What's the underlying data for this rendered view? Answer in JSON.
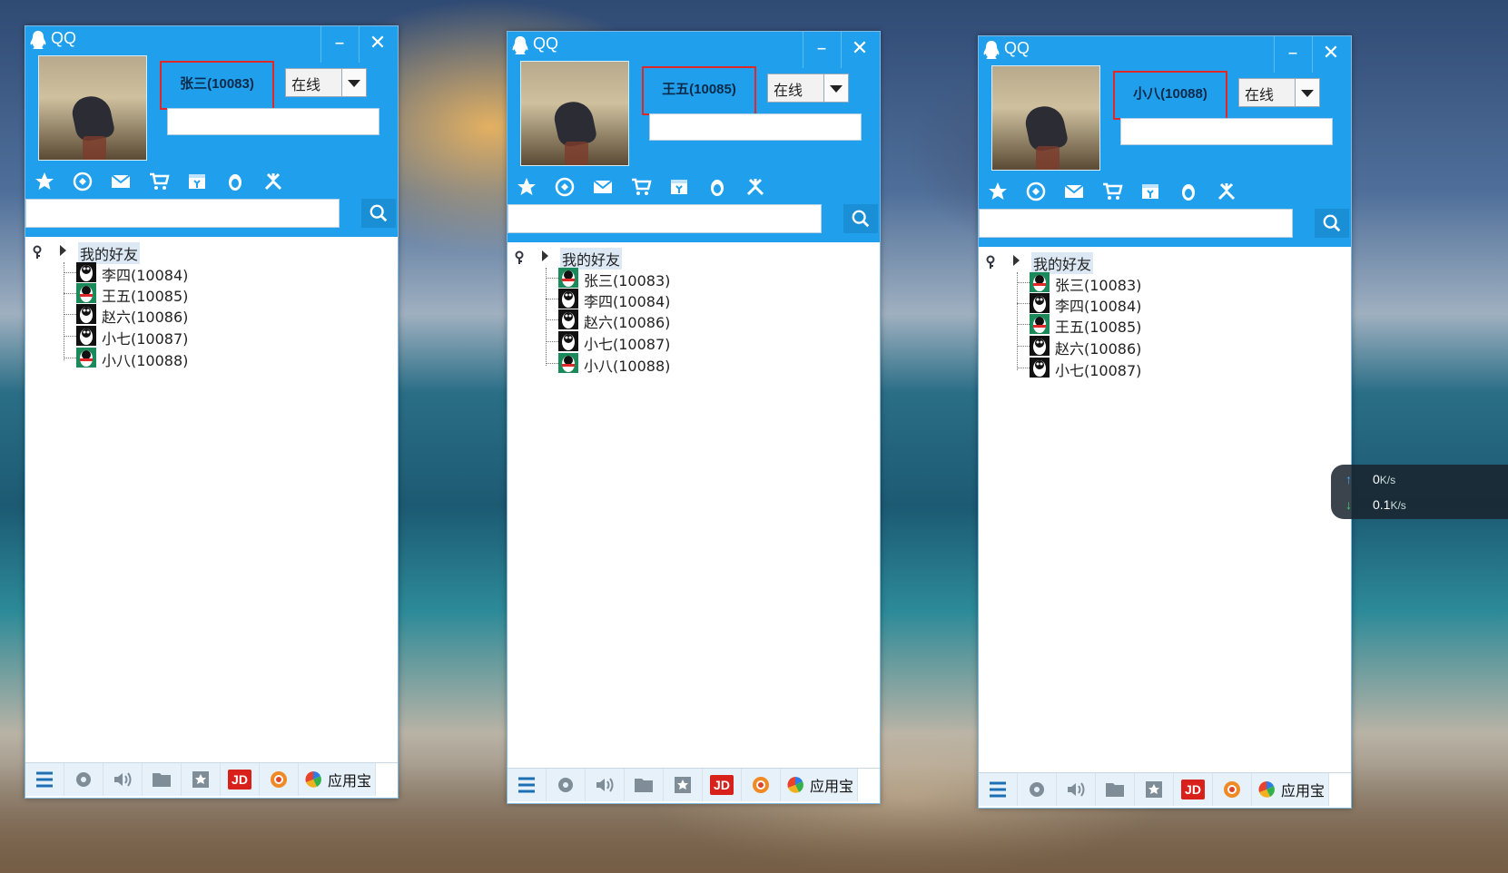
{
  "windows": [
    {
      "app_title": "QQ",
      "user_name": "张三(10083)",
      "status": "在线",
      "group_label": "我的好友",
      "friends": [
        "李四(10084)",
        "王五(10085)",
        "赵六(10086)",
        "小七(10087)",
        "小八(10088)"
      ],
      "app_store_label": "应用宝",
      "jd_label": "JD"
    },
    {
      "app_title": "QQ",
      "user_name": "王五(10085)",
      "status": "在线",
      "group_label": "我的好友",
      "friends": [
        "张三(10083)",
        "李四(10084)",
        "赵六(10086)",
        "小七(10087)",
        "小八(10088)"
      ],
      "app_store_label": "应用宝",
      "jd_label": "JD"
    },
    {
      "app_title": "QQ",
      "user_name": "小八(10088)",
      "status": "在线",
      "group_label": "我的好友",
      "friends": [
        "张三(10083)",
        "李四(10084)",
        "王五(10085)",
        "赵六(10086)",
        "小七(10087)"
      ],
      "app_store_label": "应用宝",
      "jd_label": "JD"
    }
  ],
  "net_widget": {
    "upload_value": "0",
    "upload_unit": "K/s",
    "download_value": "0.1",
    "download_unit": "K/s"
  },
  "colors": {
    "qq_header": "#20a0ec",
    "highlight_border": "#e02828",
    "group_highlight": "#dce9f4"
  },
  "icons": {
    "toolbar": [
      "star-icon",
      "qzone-icon",
      "mail-icon",
      "cart-icon",
      "wallet-icon",
      "penguin-game-icon",
      "tools-icon"
    ],
    "bottom": [
      "menu-icon",
      "settings-icon",
      "volume-icon",
      "folder-icon",
      "favorites-icon",
      "jd-icon",
      "app-icon",
      "app-store-icon"
    ]
  }
}
